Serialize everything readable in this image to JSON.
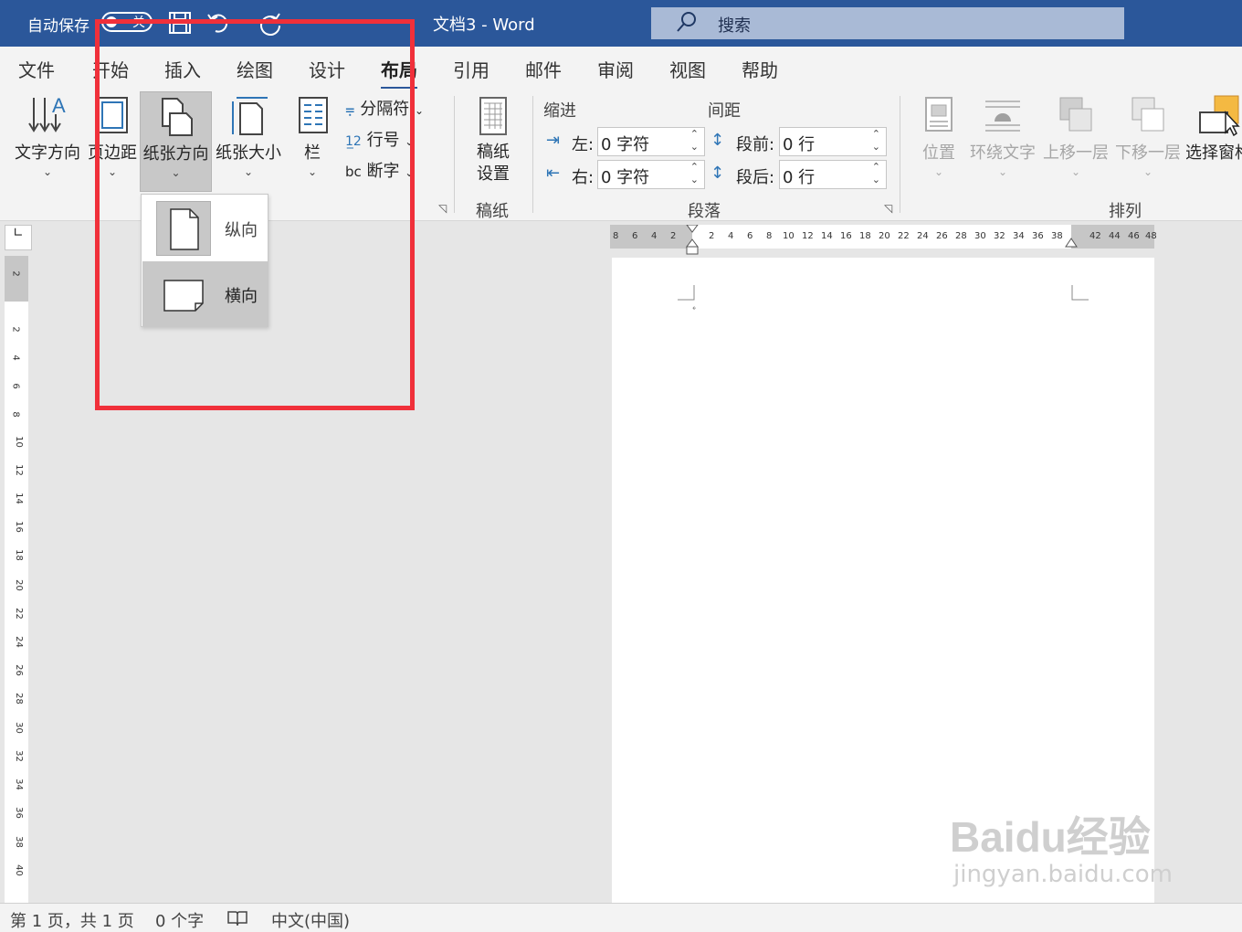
{
  "titlebar": {
    "autosave_label": "自动保存",
    "toggle_state": "关",
    "doc_title": "文档3  -  Word",
    "search_placeholder": "搜索"
  },
  "tabs": [
    "文件",
    "开始",
    "插入",
    "绘图",
    "设计",
    "布局",
    "引用",
    "邮件",
    "审阅",
    "视图",
    "帮助"
  ],
  "active_tab": "布局",
  "ribbon": {
    "page_setup": {
      "text_direction": "文字方向",
      "margins": "页边距",
      "orientation": "纸张方向",
      "size": "纸张大小",
      "columns": "栏",
      "breaks": "分隔符",
      "line_numbers": "行号",
      "hyphenation": "断字"
    },
    "manuscript": {
      "button": "稿纸设置",
      "group": "稿纸"
    },
    "paragraph": {
      "indent_header": "缩进",
      "spacing_header": "间距",
      "left_label": "左:",
      "right_label": "右:",
      "left_value": "0 字符",
      "right_value": "0 字符",
      "before_label": "段前:",
      "after_label": "段后:",
      "before_value": "0 行",
      "after_value": "0 行",
      "group": "段落"
    },
    "arrange": {
      "position": "位置",
      "wrap_text": "环绕文字",
      "bring_forward": "上移一层",
      "send_backward": "下移一层",
      "selection_pane": "选择窗格",
      "group": "排列"
    }
  },
  "orientation_menu": {
    "portrait": "纵向",
    "landscape": "横向",
    "hovered": "横向"
  },
  "ruler": {
    "horizontal": [
      "8",
      "6",
      "4",
      "2",
      "2",
      "4",
      "6",
      "8",
      "10",
      "12",
      "14",
      "16",
      "18",
      "20",
      "22",
      "24",
      "26",
      "28",
      "30",
      "32",
      "34",
      "36",
      "38",
      "42",
      "44",
      "46",
      "48"
    ],
    "vertical": [
      "2",
      "2",
      "4",
      "6",
      "8",
      "10",
      "12",
      "14",
      "16",
      "18",
      "20",
      "22",
      "24",
      "26",
      "28",
      "30",
      "32",
      "34",
      "36",
      "38",
      "40"
    ]
  },
  "statusbar": {
    "page": "第 1 页，共 1 页",
    "words": "0 个字",
    "language": "中文(中国)"
  },
  "watermark": {
    "logo": "Baidu经验",
    "url": "jingyan.baidu.com"
  }
}
